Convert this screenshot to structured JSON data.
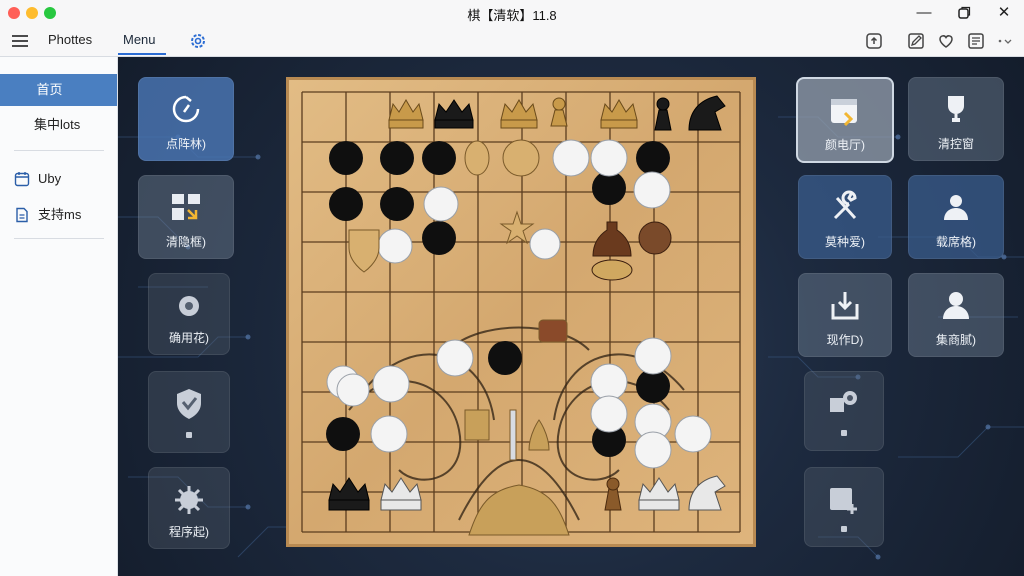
{
  "window": {
    "title": "棋【清软】11.8"
  },
  "toolbar": {
    "hamburger_icon": "menu-icon",
    "item1": "Phottes",
    "item2": "Menu",
    "settings_icon": "gear-icon",
    "right_icons": [
      "export-icon",
      "edit-icon",
      "heart-icon",
      "list-icon",
      "more-icon"
    ]
  },
  "sidebar": {
    "items": [
      {
        "label": "首页"
      },
      {
        "label": "集中lots"
      },
      {
        "label": "Uby"
      },
      {
        "label": "支持ms"
      }
    ]
  },
  "left_tiles": [
    {
      "label": "点阵林)",
      "icon": "timer-icon"
    },
    {
      "label": "清隐框)",
      "icon": "grid-icon"
    },
    {
      "label": "确用花)",
      "icon": "gear-icon"
    },
    {
      "label": "",
      "icon": "shield-icon"
    },
    {
      "label": "程序起)",
      "icon": "gear-icon"
    }
  ],
  "right_tiles": [
    {
      "label": "颜电厅)",
      "icon": "calendar-icon"
    },
    {
      "label": "清控窗",
      "icon": "trophy-icon"
    },
    {
      "label": "莫种爱)",
      "icon": "tools-icon"
    },
    {
      "label": "载席格)",
      "icon": "user-group-icon"
    },
    {
      "label": "现作D)",
      "icon": "download-icon"
    },
    {
      "label": "集商腻)",
      "icon": "user-icon"
    },
    {
      "label": "",
      "icon": "settings-icon"
    },
    {
      "label": "",
      "icon": "calendar-add-icon"
    }
  ],
  "colors": {
    "accent": "#4a7fc1",
    "board": "#d9b07a",
    "background": "#1b273a"
  }
}
